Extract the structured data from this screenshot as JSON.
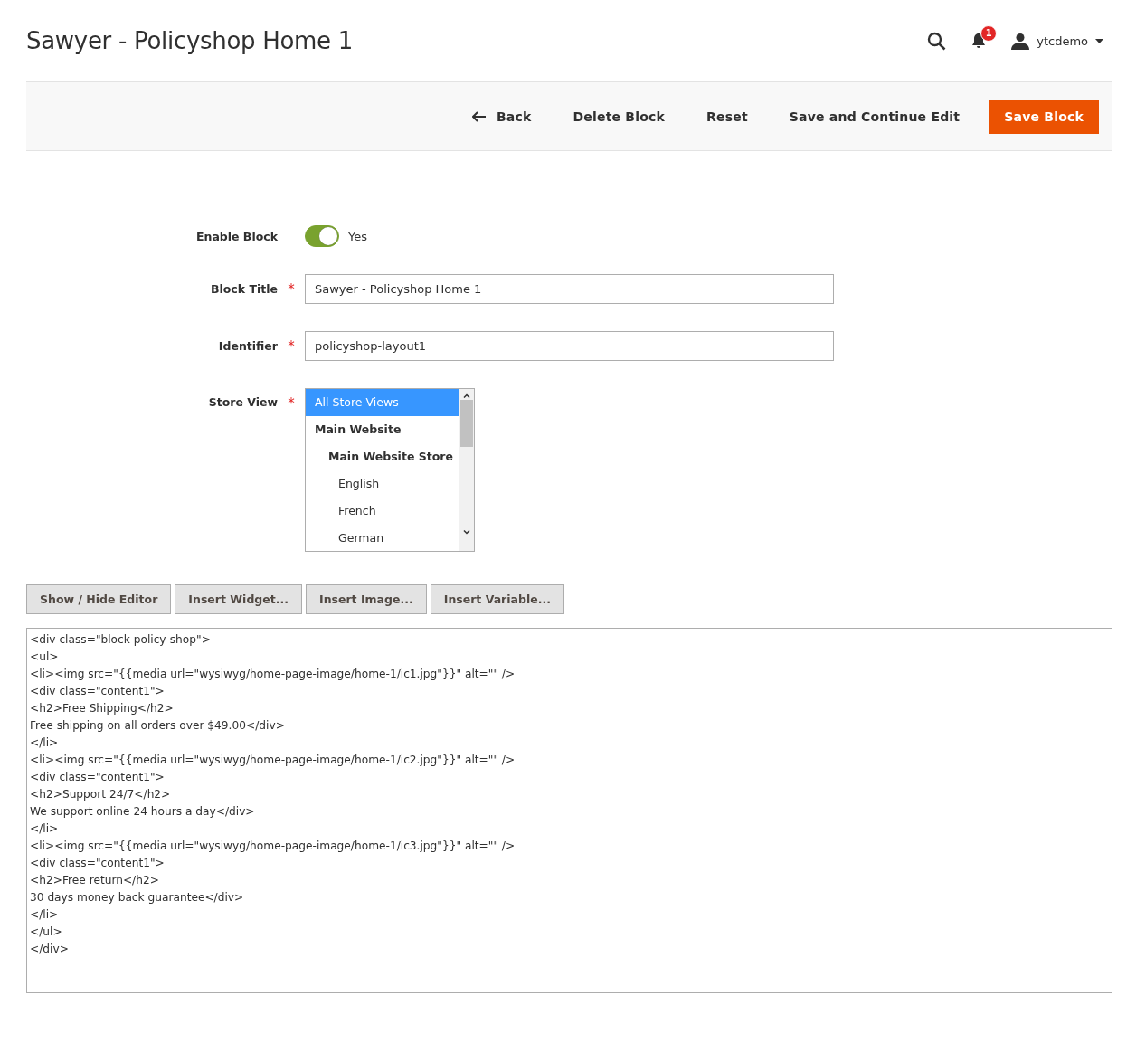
{
  "page_title": "Sawyer - Policyshop Home 1",
  "header": {
    "notifications_count": "1",
    "user": "ytcdemo"
  },
  "actions": [
    {
      "kind": "back",
      "label": "Back"
    },
    {
      "kind": "plain",
      "label": "Delete Block"
    },
    {
      "kind": "plain",
      "label": "Reset"
    },
    {
      "kind": "plain",
      "label": "Save and Continue Edit"
    },
    {
      "kind": "primary",
      "label": "Save Block"
    }
  ],
  "form": {
    "enable": {
      "label": "Enable Block",
      "on": true,
      "value_label": "Yes"
    },
    "block_title": {
      "label": "Block Title",
      "required_mark": "*",
      "value": "Sawyer - Policyshop Home 1"
    },
    "identifier": {
      "label": "Identifier",
      "required_mark": "*",
      "value": "policyshop-layout1"
    },
    "store_view": {
      "label": "Store View",
      "required_mark": "*",
      "options": [
        {
          "kind": "all",
          "label": "All Store Views",
          "selected": true
        },
        {
          "kind": "website",
          "label": "Main Website",
          "selected": false
        },
        {
          "kind": "store",
          "label": "Main Website Store",
          "selected": false
        },
        {
          "kind": "view",
          "label": "English",
          "selected": false
        },
        {
          "kind": "view",
          "label": "French",
          "selected": false
        },
        {
          "kind": "view",
          "label": "German",
          "selected": false
        }
      ]
    }
  },
  "editor_buttons": [
    {
      "label": "Show / Hide Editor"
    },
    {
      "label": "Insert Widget..."
    },
    {
      "label": "Insert Image..."
    },
    {
      "label": "Insert Variable..."
    }
  ],
  "editor_lines": [
    "<div class=\"block policy-shop\">",
    "<ul>",
    "<li><img src=\"{{media url=\"wysiwyg/home-page-image/home-1/ic1.jpg\"}}\" alt=\"\" />",
    "<div class=\"content1\">",
    "<h2>Free Shipping</h2>",
    "Free shipping on all orders over $49.00</div>",
    "</li>",
    "<li><img src=\"{{media url=\"wysiwyg/home-page-image/home-1/ic2.jpg\"}}\" alt=\"\" />",
    "<div class=\"content1\">",
    "<h2>Support 24/7</h2>",
    "We support online 24 hours a day</div>",
    "</li>",
    "<li><img src=\"{{media url=\"wysiwyg/home-page-image/home-1/ic3.jpg\"}}\" alt=\"\" />",
    "<div class=\"content1\">",
    "<h2>Free return</h2>",
    "30 days money back guarantee</div>",
    "</li>",
    "</ul>",
    "</div>"
  ]
}
